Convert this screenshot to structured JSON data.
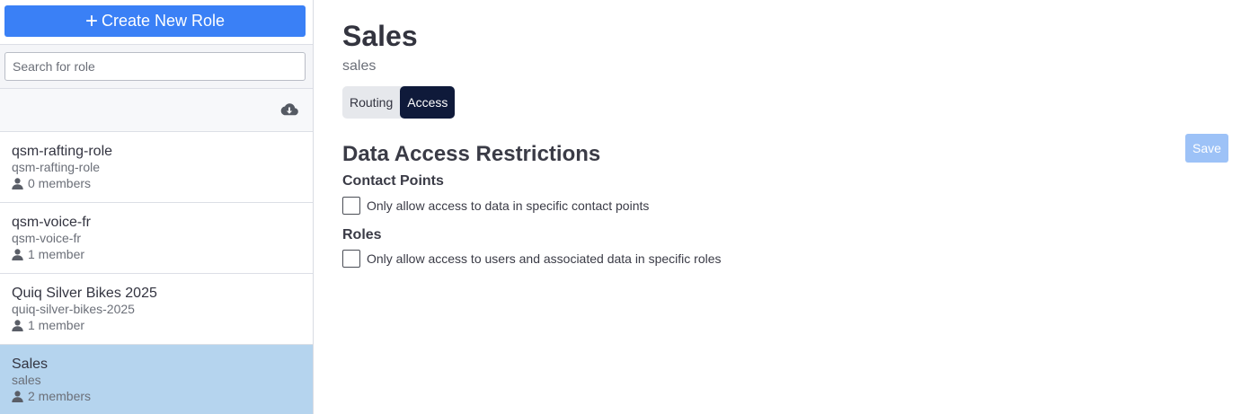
{
  "sidebar": {
    "create_button_label": "Create New Role",
    "search_placeholder": "Search for role",
    "roles": [
      {
        "name": "qsm-rafting-role",
        "slug": "qsm-rafting-role",
        "members": "0 members"
      },
      {
        "name": "qsm-voice-fr",
        "slug": "qsm-voice-fr",
        "members": "1 member"
      },
      {
        "name": "Quiq Silver Bikes 2025",
        "slug": "quiq-silver-bikes-2025",
        "members": "1 member"
      },
      {
        "name": "Sales",
        "slug": "sales",
        "members": "2 members"
      }
    ],
    "selected_role": "Sales"
  },
  "main": {
    "title": "Sales",
    "slug": "sales",
    "tabs": [
      {
        "label": "Routing",
        "active": false
      },
      {
        "label": "Access",
        "active": true
      }
    ],
    "section_title": "Data Access Restrictions",
    "save_label": "Save",
    "contact_points": {
      "heading": "Contact Points",
      "option_label": "Only allow access to data in specific contact points",
      "checked": false
    },
    "roles_restriction": {
      "heading": "Roles",
      "option_label": "Only allow access to users and associated data in specific roles",
      "checked": false
    }
  },
  "colors": {
    "primary": "#3a80f6",
    "tab_active": "#0f1a3a",
    "selected_row": "#b5d4ee",
    "save_disabled": "#9dc2f7"
  },
  "icons": {
    "create": "plus-icon",
    "download": "cloud-download-icon",
    "member": "user-icon"
  }
}
